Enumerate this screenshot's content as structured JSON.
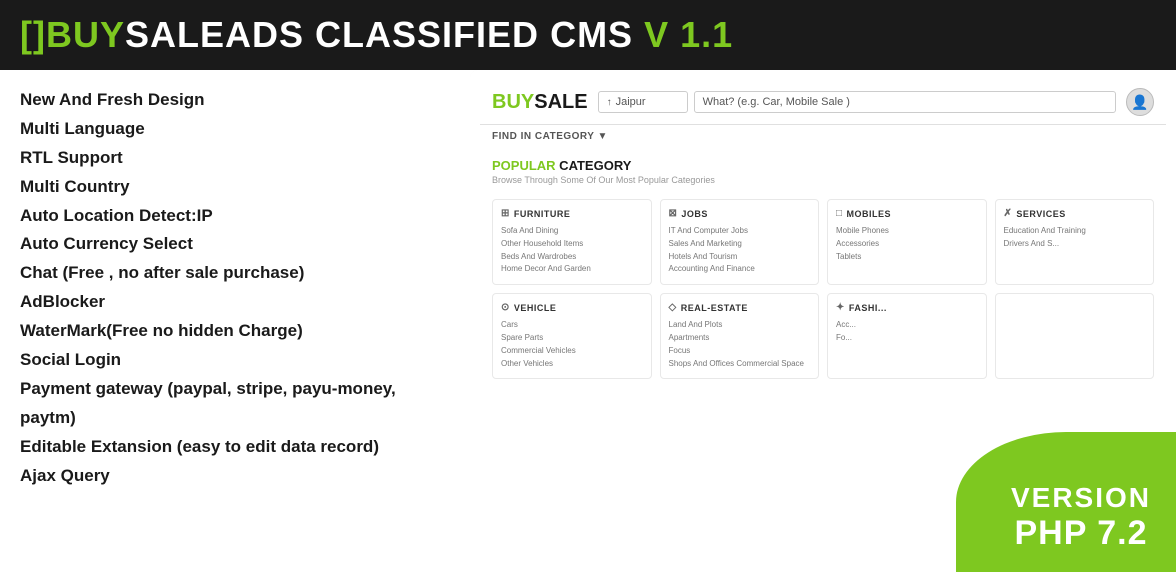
{
  "header": {
    "bracket_open": "[",
    "bracket_close": "]",
    "buy": "BUY",
    "sale": "SALE",
    "dash": " - ",
    "ads": "ADS CLASSIFIED",
    "cms": " CMS",
    "version": " V 1.1"
  },
  "features": {
    "items": [
      "New And Fresh Design",
      "Multi Language",
      "RTL Support",
      "Multi Country",
      "Auto Location Detect:IP",
      "Auto Currency Select",
      "Chat (Free , no after sale purchase)",
      "AdBlocker",
      "WaterMark(Free no hidden Charge)",
      "Social Login",
      "Payment gateway (paypal, stripe, payu-money, paytm)",
      "Editable Extansion (easy to edit data record)",
      "Ajax Query"
    ]
  },
  "app": {
    "logo_buy": "BUY",
    "logo_sale": "SALE",
    "location_placeholder": "Jaipur",
    "search_placeholder": "What? (e.g. Car, Mobile Sale )",
    "nav_text": "FIND IN CATEGORY ▼",
    "popular_label_1": "POPULAR",
    "popular_label_2": " CATEGORY",
    "popular_sub": "Browse Through Some Of Our Most Popular Categories",
    "categories_row1": [
      {
        "icon": "⊞",
        "title": "FURNITURE",
        "items": [
          "Sofa And Dining",
          "Other Household Items",
          "Beds And Wardrobes",
          "Home Decor And Garden"
        ]
      },
      {
        "icon": "⊠",
        "title": "JOBS",
        "items": [
          "IT And Computer Jobs",
          "Sales And Marketing",
          "Hotels And Tourism",
          "Accounting And Finance"
        ]
      },
      {
        "icon": "□",
        "title": "MOBILES",
        "items": [
          "Mobile Phones",
          "Accessories",
          "Tablets"
        ]
      },
      {
        "icon": "✗",
        "title": "SERVICES",
        "items": [
          "Education And Training",
          "Drivers And S..."
        ]
      }
    ],
    "categories_row2": [
      {
        "icon": "⊙",
        "title": "VEHICLE",
        "items": [
          "Cars",
          "Spare Parts",
          "Commercial Vehicles",
          "Other Vehicles"
        ]
      },
      {
        "icon": "◇",
        "title": "REAL-ESTATE",
        "items": [
          "Land And Plots",
          "Apartments",
          "Focus",
          "Shops And Offices Commercial Space"
        ]
      },
      {
        "icon": "✦",
        "title": "FASHI...",
        "items": [
          "Acc...",
          "Fo..."
        ]
      },
      {
        "icon": "",
        "title": "",
        "items": []
      }
    ]
  },
  "version_badge": {
    "line1": "VERSION",
    "line2": "PHP 7.2"
  }
}
